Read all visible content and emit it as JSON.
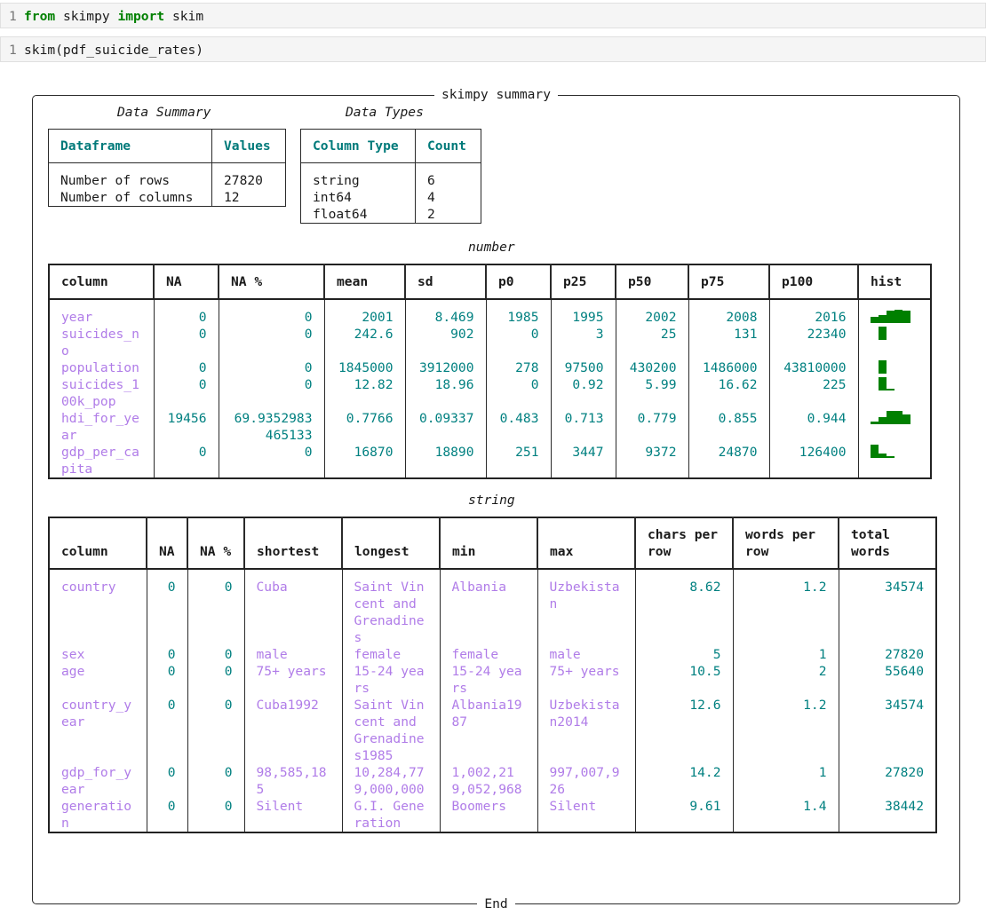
{
  "cells": [
    {
      "line": "1",
      "code_parts": [
        [
          "kw",
          "from"
        ],
        [
          "txt",
          " skimpy "
        ],
        [
          "kw",
          "import"
        ],
        [
          "txt",
          " skim"
        ]
      ]
    },
    {
      "line": "1",
      "code_parts": [
        [
          "txt",
          "skim(pdf_suicide_rates)"
        ]
      ]
    }
  ],
  "summary": {
    "title": "skimpy summary",
    "footer": "End",
    "data_summary": {
      "caption": "Data Summary",
      "headers": [
        "Dataframe",
        "Values"
      ],
      "rows": [
        [
          "Number of rows",
          "27820"
        ],
        [
          "Number of columns",
          "12"
        ]
      ]
    },
    "data_types": {
      "caption": "Data Types",
      "headers": [
        "Column Type",
        "Count"
      ],
      "rows": [
        [
          "string",
          "6"
        ],
        [
          "int64",
          "4"
        ],
        [
          "float64",
          "2"
        ]
      ]
    },
    "number": {
      "caption": "number",
      "headers": [
        "column",
        "NA",
        "NA %",
        "mean",
        "sd",
        "p0",
        "p25",
        "p50",
        "p75",
        "p100",
        "hist"
      ],
      "rows": [
        {
          "cells": [
            "year",
            "0",
            "0",
            "2001",
            "8.469",
            "1985",
            "1995",
            "2002",
            "2008",
            "2016"
          ],
          "hist": [
            0.45,
            0.6,
            0.9,
            1.0,
            0.9
          ]
        },
        {
          "cells": [
            "suicides_no",
            "0",
            "0",
            "242.6",
            "902",
            "0",
            "3",
            "25",
            "131",
            "22340"
          ],
          "hist": [
            0,
            1.0,
            0,
            0,
            0
          ]
        },
        {
          "cells": [
            "population",
            "0",
            "0",
            "1845000",
            "3912000",
            "278",
            "97500",
            "430200",
            "1486000",
            "43810000"
          ],
          "hist": [
            0,
            1.0,
            0,
            0,
            0
          ]
        },
        {
          "cells": [
            "suicides_100k_pop",
            "0",
            "0",
            "12.82",
            "18.96",
            "0",
            "0.92",
            "5.99",
            "16.62",
            "225"
          ],
          "hist": [
            0,
            1.0,
            0.15,
            0,
            0
          ]
        },
        {
          "cells": [
            "hdi_for_year",
            "19456",
            "69.9352983465133",
            "0.7766",
            "0.09337",
            "0.483",
            "0.713",
            "0.779",
            "0.855",
            "0.944"
          ],
          "hist": [
            0.2,
            0.5,
            1.0,
            1.0,
            0.7
          ]
        },
        {
          "cells": [
            "gdp_per_capita",
            "0",
            "0",
            "16870",
            "18890",
            "251",
            "3447",
            "9372",
            "24870",
            "126400"
          ],
          "hist": [
            1.0,
            0.35,
            0.1,
            0,
            0
          ]
        }
      ]
    },
    "string": {
      "caption": "string",
      "headers": [
        "column",
        "NA",
        "NA %",
        "shortest",
        "longest",
        "min",
        "max",
        "chars per row",
        "words per row",
        "total words"
      ],
      "rows": [
        [
          "country",
          "0",
          "0",
          "Cuba",
          "Saint Vincent and Grenadines",
          "Albania",
          "Uzbekistan",
          "8.62",
          "1.2",
          "34574"
        ],
        [
          "sex",
          "0",
          "0",
          "male",
          "female",
          "female",
          "male",
          "5",
          "1",
          "27820"
        ],
        [
          "age",
          "0",
          "0",
          "75+ years",
          "15-24 years",
          "15-24 years",
          "75+ years",
          "10.5",
          "2",
          "55640"
        ],
        [
          "country_year",
          "0",
          "0",
          "Cuba1992",
          "Saint Vincent and Grenadines1985",
          "Albania1987",
          "Uzbekistan2014",
          "12.6",
          "1.2",
          "34574"
        ],
        [
          "gdp_for_year",
          "0",
          "0",
          "98,585,185",
          "10,284,779,000,000",
          "1,002,219,052,968",
          "997,007,926",
          "14.2",
          "1",
          "27820"
        ],
        [
          "generation",
          "0",
          "0",
          "Silent",
          "G.I. Generation",
          "Boomers",
          "Silent",
          "9.61",
          "1.4",
          "38442"
        ]
      ]
    }
  },
  "colors": {
    "teal": "#008080",
    "purple": "#b07ce8",
    "green": "#008000"
  }
}
